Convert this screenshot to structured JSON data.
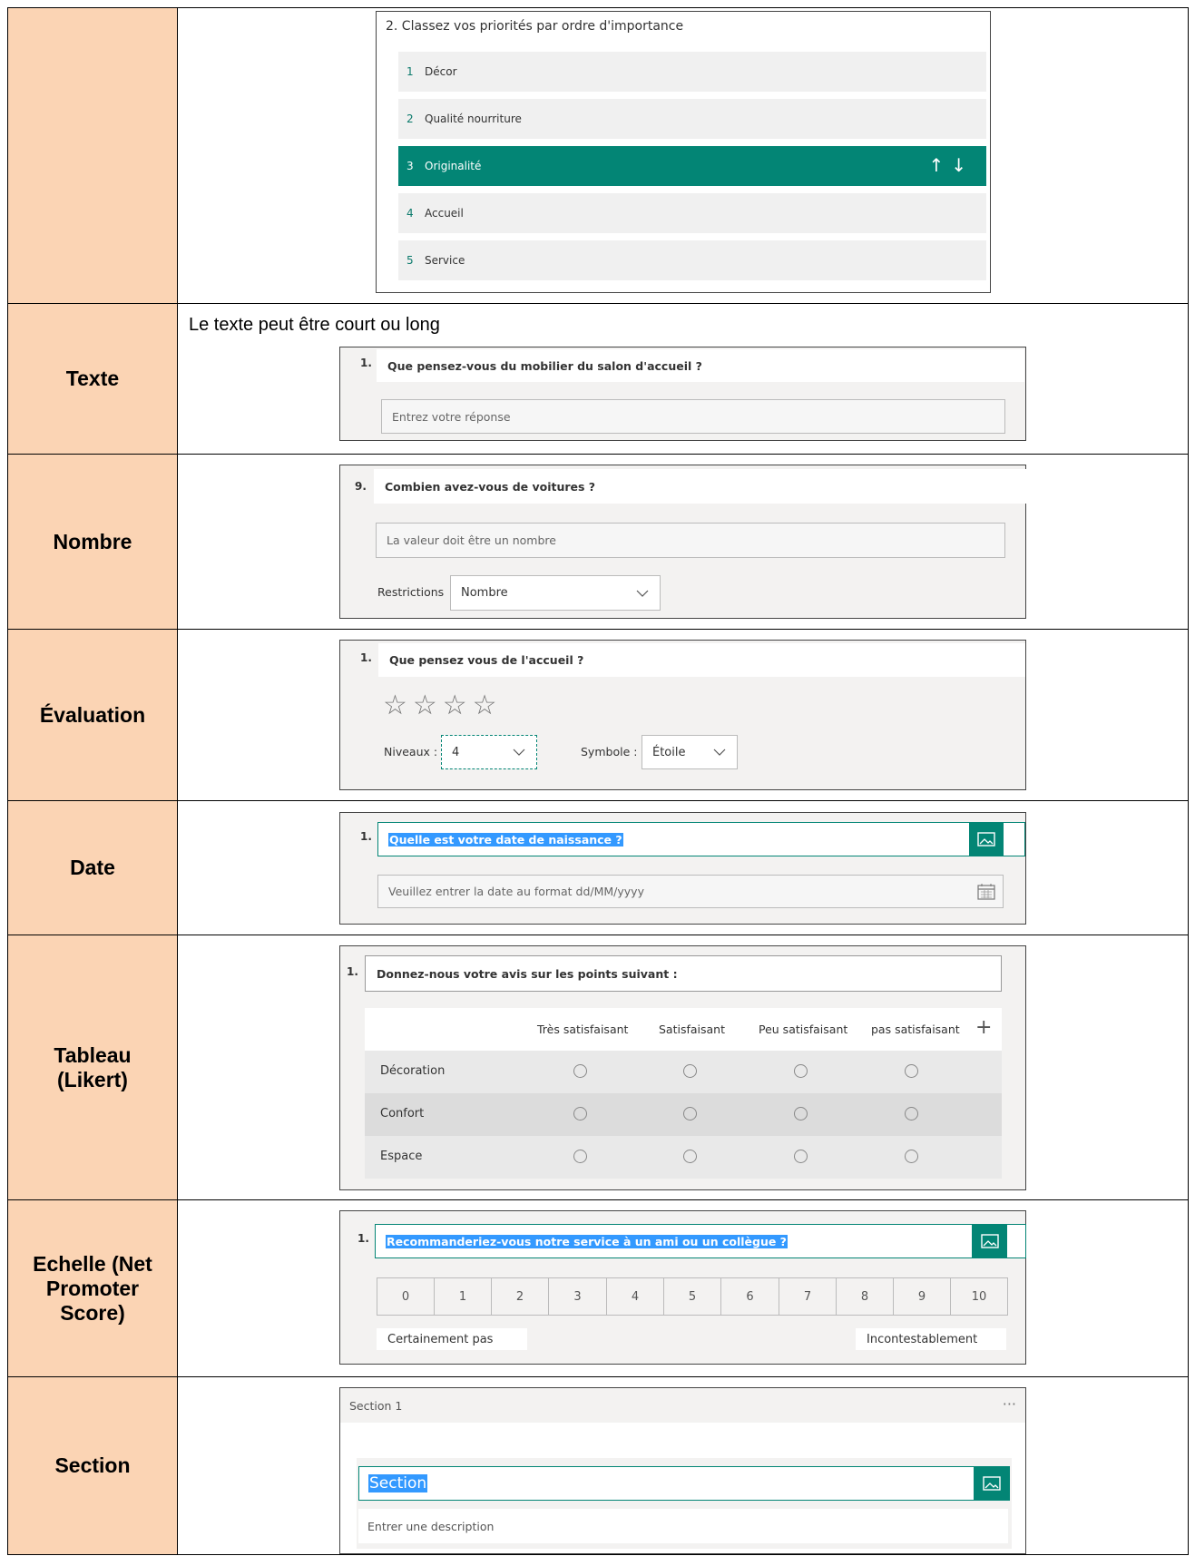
{
  "rows": {
    "ranking": {
      "label": "",
      "title": "2. Classez vos priorités par ordre d'importance",
      "items": [
        {
          "num": "1",
          "text": "Décor"
        },
        {
          "num": "2",
          "text": "Qualité nourriture"
        },
        {
          "num": "3",
          "text": "Originalité"
        },
        {
          "num": "4",
          "text": "Accueil"
        },
        {
          "num": "5",
          "text": "Service"
        }
      ],
      "arrows": "↑↓"
    },
    "texte": {
      "label": "Texte",
      "intro": "Le texte peut être court ou long",
      "qnum": "1.",
      "question": "Que pensez-vous du mobilier du salon d'accueil ?",
      "placeholder": "Entrez votre réponse"
    },
    "nombre": {
      "label": "Nombre",
      "qnum": "9.",
      "question": "Combien avez-vous de voitures ?",
      "placeholder": "La valeur doit être un nombre",
      "restrictions_label": "Restrictions",
      "restrictions_value": "Nombre"
    },
    "evaluation": {
      "label": "Évaluation",
      "qnum": "1.",
      "question": "Que pensez vous de l'accueil ?",
      "stars": "☆☆☆☆",
      "levels_label": "Niveaux :",
      "levels_value": "4",
      "symbol_label": "Symbole :",
      "symbol_value": "Étoile"
    },
    "date": {
      "label": "Date",
      "qnum": "1.",
      "question": "Quelle est votre date de naissance ?",
      "placeholder": "Veuillez entrer la date au format dd/MM/yyyy"
    },
    "tableau": {
      "label_line1": "Tableau",
      "label_line2": "(Likert)",
      "qnum": "1.",
      "question": "Donnez-nous votre avis sur les points suivant :",
      "columns": [
        "Très satisfaisant",
        "Satisfaisant",
        "Peu satisfaisant",
        "pas satisfaisant"
      ],
      "add": "+",
      "rows": [
        "Décoration",
        "Confort",
        "Espace"
      ]
    },
    "echelle": {
      "label_line1": "Echelle (Net",
      "label_line2": "Promoter",
      "label_line3": "Score)",
      "qnum": "1.",
      "question": "Recommanderiez-vous notre service à un ami ou un collègue ?",
      "scale": [
        "0",
        "1",
        "2",
        "3",
        "4",
        "5",
        "6",
        "7",
        "8",
        "9",
        "10"
      ],
      "low_label": "Certainement pas",
      "high_label": "Incontestablement"
    },
    "section": {
      "label": "Section",
      "header": "Section 1",
      "more": "···",
      "title": "Section",
      "description": "Entrer une description"
    }
  },
  "colors": {
    "label_bg": "#fbd4b4",
    "accent": "#038575",
    "highlight": "#3399ff"
  }
}
